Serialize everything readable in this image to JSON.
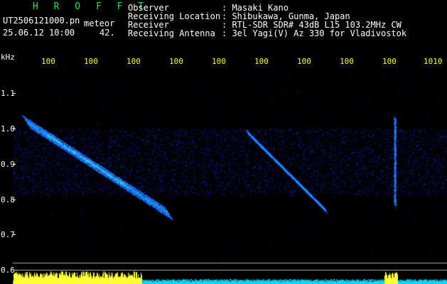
{
  "header": {
    "logo_text": "H R O F F T",
    "filename": "UT2506121000.pn",
    "event_type": "meteor",
    "datetime": "25.06.12 10:00",
    "count": "42."
  },
  "info": {
    "rows": [
      {
        "label": "Observer",
        "value": ": Masaki Kano"
      },
      {
        "label": "Receiving Location",
        "value": ": Shibukawa, Gunma, Japan"
      },
      {
        "label": "Receiver",
        "value": ": RTL-SDR SDR# 43dB L15 103.2MHz CW"
      },
      {
        "label": "Receiving Antenna",
        "value": ": 3el Yagi(V) Az 330 for Vladivostok"
      }
    ]
  },
  "axes": {
    "y_unit": "kHz",
    "y_ticks": [
      "1.1",
      "1.0",
      "0.9",
      "0.8",
      "0.7",
      "0.6"
    ],
    "x_ticks": [
      "100",
      "100",
      "100",
      "100",
      "100",
      "100",
      "100",
      "100",
      "100",
      "1010"
    ]
  },
  "colors": {
    "background": "#000000",
    "noise": "#1020c0",
    "signal_mid": "#20a0ff",
    "signal_hot": "#50ffc0",
    "power_trace_top": "#ffff33",
    "power_trace_bottom": "#00d8ff"
  },
  "spectrogram": {
    "y_range_khz": [
      0.58,
      1.15
    ],
    "noise_band_khz": [
      0.82,
      1.0
    ],
    "traces": [
      {
        "t_start": 0.03,
        "f_start": 1.02,
        "t_end": 0.36,
        "f_end": 0.77,
        "intensity": "strong"
      },
      {
        "t_start": 0.54,
        "f_start": 0.99,
        "t_end": 0.72,
        "f_end": 0.78,
        "intensity": "medium"
      },
      {
        "t_start": 0.88,
        "f_start": 1.03,
        "t_end": 0.88,
        "f_end": 0.79,
        "intensity": "weak"
      }
    ]
  }
}
